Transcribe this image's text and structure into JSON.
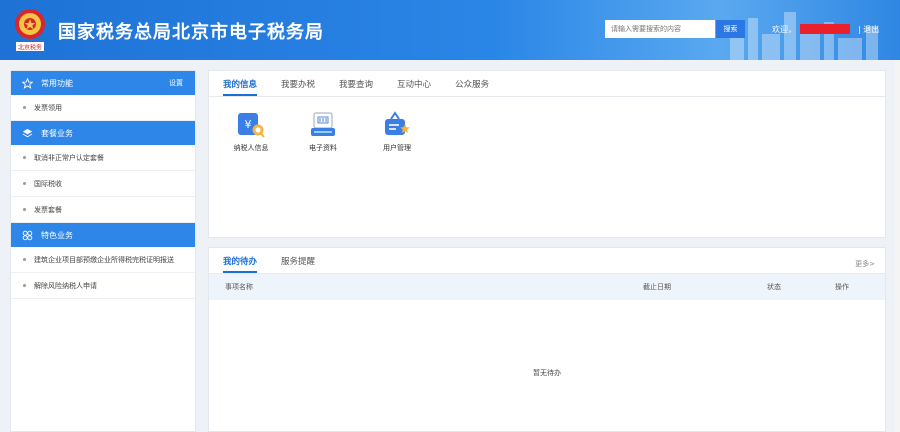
{
  "header": {
    "site_title": "国家税务总局北京市电子税务局",
    "search_placeholder": "请输入需要搜索的内容",
    "search_button": "搜索",
    "welcome_label": "欢迎，",
    "logout_label": "| 退出",
    "emblem_text": "北京税务"
  },
  "sidebar": {
    "groups": [
      {
        "title": "常用功能",
        "icon": "star-icon",
        "action": "设置",
        "items": [
          "发票领用"
        ]
      },
      {
        "title": "套餐业务",
        "icon": "layers-icon",
        "action": "",
        "items": [
          "取消非正常户认定套餐",
          "国际税收",
          "发票套餐"
        ]
      },
      {
        "title": "特色业务",
        "icon": "grid-icon",
        "action": "",
        "items": [
          "建筑企业项目部预缴企业所得税完税证明报送",
          "解除风险纳税人申请"
        ]
      }
    ]
  },
  "info_panel": {
    "tabs": [
      "我的信息",
      "我要办税",
      "我要查询",
      "互动中心",
      "公众服务"
    ],
    "active_tab": "我的信息",
    "apps": [
      {
        "label": "纳税人信息",
        "icon": "taxpayer-info-icon"
      },
      {
        "label": "电子资料",
        "icon": "e-document-icon"
      },
      {
        "label": "用户管理",
        "icon": "user-management-icon"
      }
    ]
  },
  "todo_panel": {
    "tabs": [
      "我的待办",
      "服务提醒"
    ],
    "active_tab": "我的待办",
    "more_link": "更多>",
    "columns": [
      "事项名称",
      "截止日期",
      "状态",
      "操作"
    ],
    "rows": [],
    "empty_text": "暂无待办"
  },
  "colors": {
    "header_blue": "#1e72d6",
    "sidebar_head_blue": "#2d86e8",
    "active_tab_blue": "#1c6fd6",
    "redaction_red": "#e8212b"
  }
}
